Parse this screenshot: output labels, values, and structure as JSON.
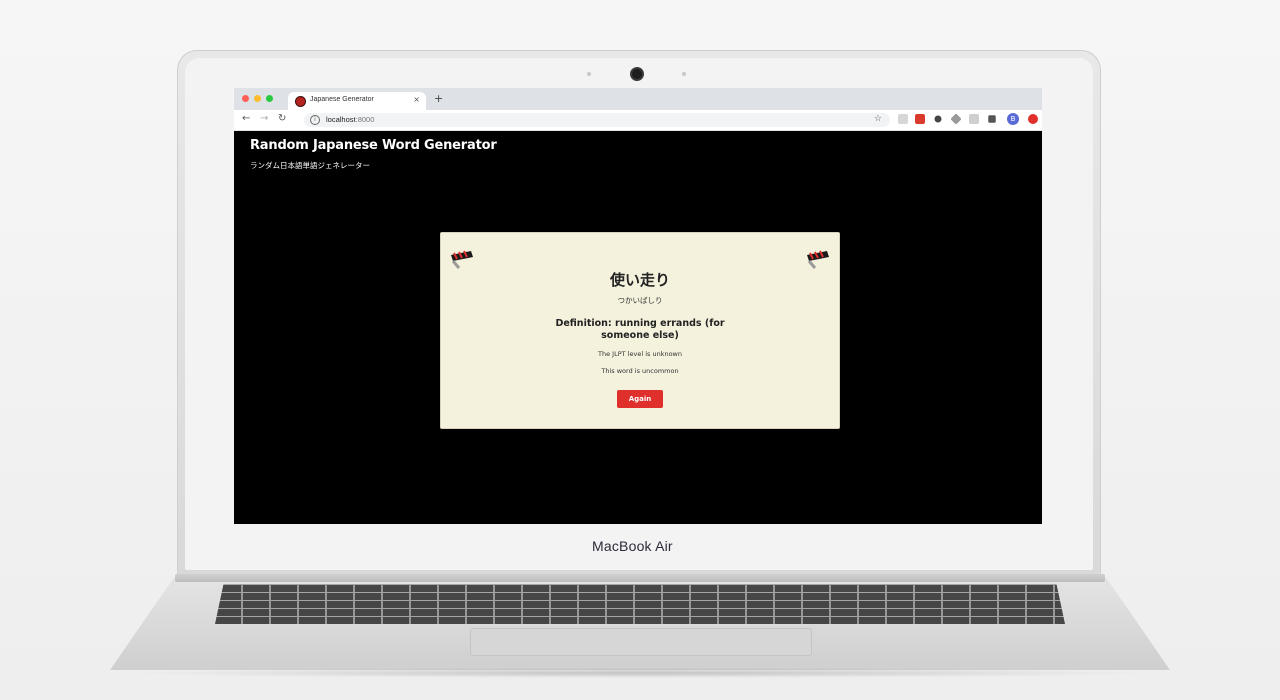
{
  "browser": {
    "tab_title": "Japanese Generator",
    "tab_close_glyph": "×",
    "new_tab_glyph": "+",
    "url_host": "localhost",
    "url_port": ":8000",
    "profile_initial": "B",
    "traffic_colors": [
      "#ff5f57",
      "#febc2e",
      "#28c840"
    ]
  },
  "page": {
    "title": "Random Japanese Word Generator",
    "subtitle": "ランダム日本語単語ジェネレーター"
  },
  "card": {
    "word": "使い走り",
    "reading": "つかいばしり",
    "definition": "Definition: running errands (for someone else)",
    "jlpt_text": "The JLPT level is unknown",
    "commonality_text": "This word is uncommon",
    "again_label": "Again"
  },
  "device": {
    "brand_label": "MacBook Air"
  },
  "colors": {
    "card_background": "#f4f1dd",
    "button_red": "#e0302b",
    "page_background": "#000000"
  }
}
